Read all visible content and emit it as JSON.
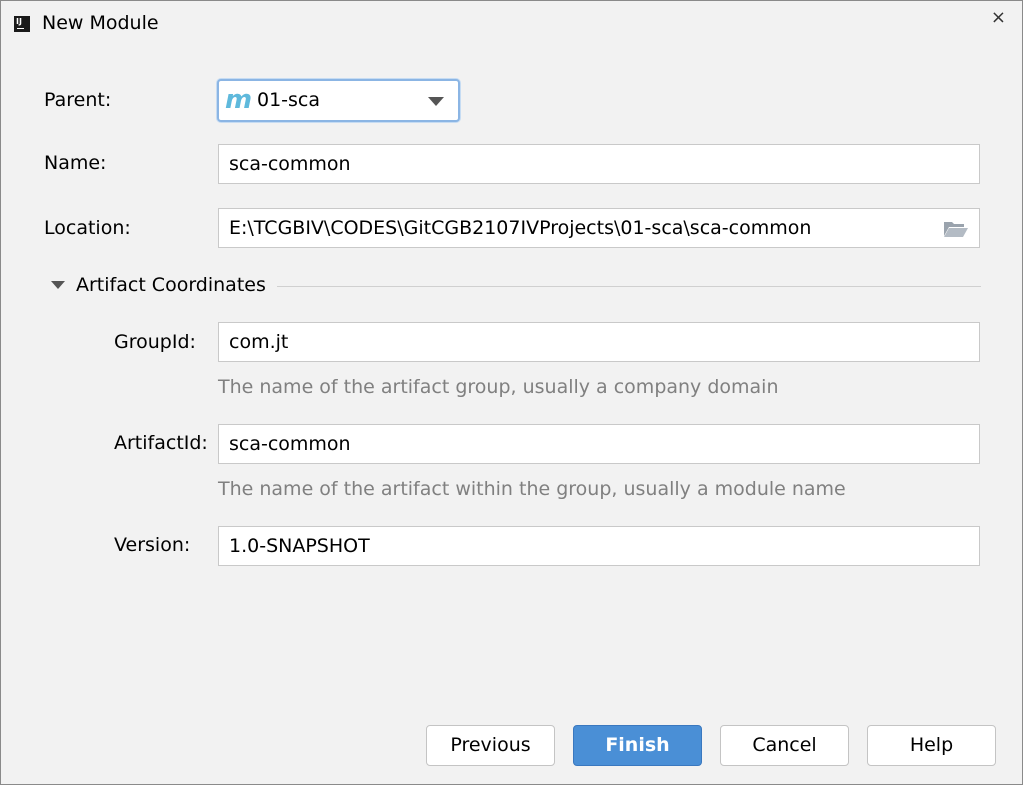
{
  "window": {
    "title": "New Module",
    "close_glyph": "×",
    "app_icon_text": "IJ"
  },
  "form": {
    "parent": {
      "label": "Parent:",
      "value": "01-sca",
      "icon": "maven-module-icon"
    },
    "name": {
      "label": "Name:",
      "value": "sca-common"
    },
    "location": {
      "label": "Location:",
      "value": "E:\\TCGBIV\\CODES\\GitCGB2107IVProjects\\01-sca\\sca-common",
      "icon": "folder-open-icon"
    }
  },
  "artifact": {
    "section_title": "Artifact Coordinates",
    "group_id": {
      "label": "GroupId:",
      "value": "com.jt",
      "hint": "The name of the artifact group, usually a company domain"
    },
    "artifact_id": {
      "label": "ArtifactId:",
      "value": "sca-common",
      "hint": "The name of the artifact within the group, usually a module name"
    },
    "version": {
      "label": "Version:",
      "value": "1.0-SNAPSHOT"
    }
  },
  "buttons": {
    "previous": "Previous",
    "finish": "Finish",
    "cancel": "Cancel",
    "help": "Help"
  },
  "colors": {
    "accent": "#4a8fd6",
    "focus_border": "#8bb5e4",
    "hint_text": "#808080"
  }
}
